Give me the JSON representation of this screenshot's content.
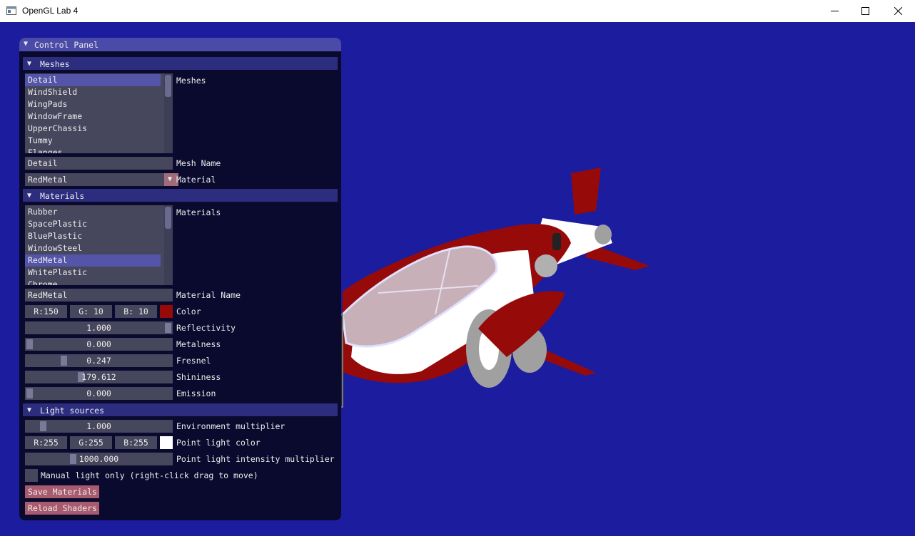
{
  "window": {
    "title": "OpenGL Lab 4"
  },
  "panel": {
    "title": "Control Panel"
  },
  "meshes": {
    "header": "Meshes",
    "list_label": "Meshes",
    "items": [
      "Detail",
      "WindShield",
      "WingPads",
      "WindowFrame",
      "UpperChassis",
      "Tummy",
      "Flanges"
    ],
    "selected_index": 0,
    "mesh_name": "Detail",
    "mesh_name_label": "Mesh Name",
    "material": "RedMetal",
    "material_label": "Material"
  },
  "materials": {
    "header": "Materials",
    "list_label": "Materials",
    "items": [
      "Rubber",
      "SpacePlastic",
      "BluePlastic",
      "WindowSteel",
      "RedMetal",
      "WhitePlastic",
      "Chrome"
    ],
    "selected_index": 4,
    "material_name": "RedMetal",
    "material_name_label": "Material Name",
    "color": {
      "r": "R:150",
      "g": "G: 10",
      "b": "B: 10",
      "label": "Color",
      "hex": "#960a0a"
    },
    "reflectivity": {
      "value": "1.000",
      "label": "Reflectivity",
      "fraction": 1.0
    },
    "metalness": {
      "value": "0.000",
      "label": "Metalness",
      "fraction": 0.0
    },
    "fresnel": {
      "value": "0.247",
      "label": "Fresnel",
      "fraction": 0.247
    },
    "shininess": {
      "value": "179.612",
      "label": "Shininess",
      "fraction": 0.36
    },
    "emission": {
      "value": "0.000",
      "label": "Emission",
      "fraction": 0.0
    }
  },
  "lights": {
    "header": "Light sources",
    "environment": {
      "value": "1.000",
      "label": "Environment multiplier",
      "fraction": 0.1
    },
    "point_color": {
      "r": "R:255",
      "g": "G:255",
      "b": "B:255",
      "label": "Point light color",
      "hex": "#ffffff"
    },
    "point_intensity": {
      "value": "1000.000",
      "label": "Point light intensity multiplier",
      "fraction": 0.33
    },
    "manual_label": "Manual light only (right-click drag to move)",
    "manual_checked": false
  },
  "buttons": {
    "save": "Save Materials",
    "reload": "Reload Shaders"
  },
  "colors": {
    "viewport": "#1c1c9e",
    "panel_bg": "#0a0a2e",
    "header": "#2d2d80",
    "selected": "#5454a8",
    "button": "#a85a6e"
  },
  "icons": [
    "app-icon",
    "minimize-icon",
    "maximize-icon",
    "close-icon",
    "triangle-down-icon"
  ]
}
